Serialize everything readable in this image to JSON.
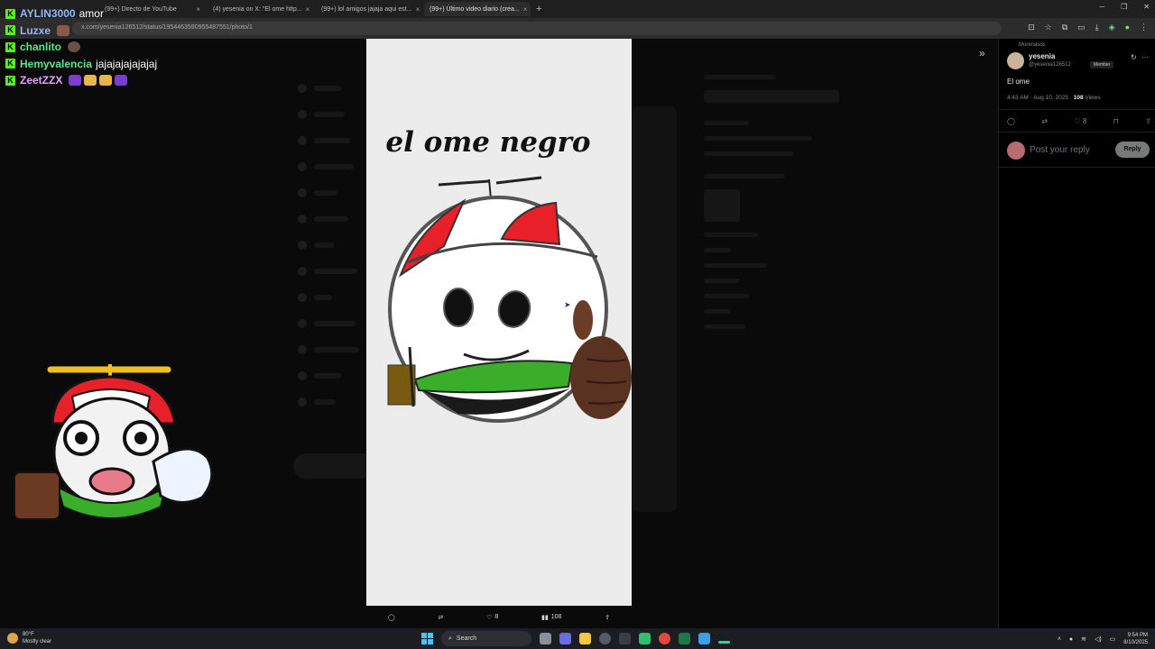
{
  "browser": {
    "tabs": [
      {
        "label": "(99+) Directo de YouTube",
        "active": false
      },
      {
        "label": "(4) yesenia on X: \"El ome http...",
        "active": false
      },
      {
        "label": "(99+) lol amigos jajaja aqui est...",
        "active": false
      },
      {
        "label": "(99+) Último video diario (crea...",
        "active": true
      }
    ],
    "url": "x.com/yesenia126512/status/1954463590955487551/photo/1"
  },
  "chat": {
    "messages": [
      {
        "user": "AYLIN3000",
        "text": "amor",
        "color": "#8fb9ff",
        "emote_colors": []
      },
      {
        "user": "Luzxe",
        "text": "",
        "color": "#8fb9ff",
        "emote_colors": [
          "#8a5a44"
        ]
      },
      {
        "user": "chanlito",
        "text": "",
        "color": "#5de68a",
        "emote_colors": [
          "#6b5048"
        ]
      },
      {
        "user": "Hemyvalencia",
        "text": "jajajajajajajaj",
        "color": "#5de68a",
        "emote_colors": []
      },
      {
        "user": "ZeetZZX",
        "text": "",
        "color": "#e3a6ff",
        "emote_colors": [
          "#7a3fd1",
          "#e8b54a",
          "#e8b54a",
          "#7a3fd1"
        ]
      }
    ]
  },
  "viewer": {
    "title": "el ome negro",
    "actions": {
      "likes": "8",
      "views": "108"
    }
  },
  "post": {
    "community": "Morenasos",
    "author": "yesenia",
    "handle": "@yesenia126512",
    "badge": "Member",
    "text": "El ome",
    "meta_time": "4:43 AM · Aug 10, 2025 · ",
    "views_count": "108",
    "views_label": " Views",
    "likes": "8",
    "reply_placeholder": "Post your reply",
    "reply_button": "Reply"
  },
  "taskbar": {
    "temperature": "80°F",
    "weather": "Mostly clear",
    "search": "Search",
    "time": "9:54 PM",
    "date": "8/10/2025"
  },
  "colors": {
    "kick_green": "#53fc18",
    "accent_red": "#e8202a",
    "accent_green": "#3aae2a"
  }
}
